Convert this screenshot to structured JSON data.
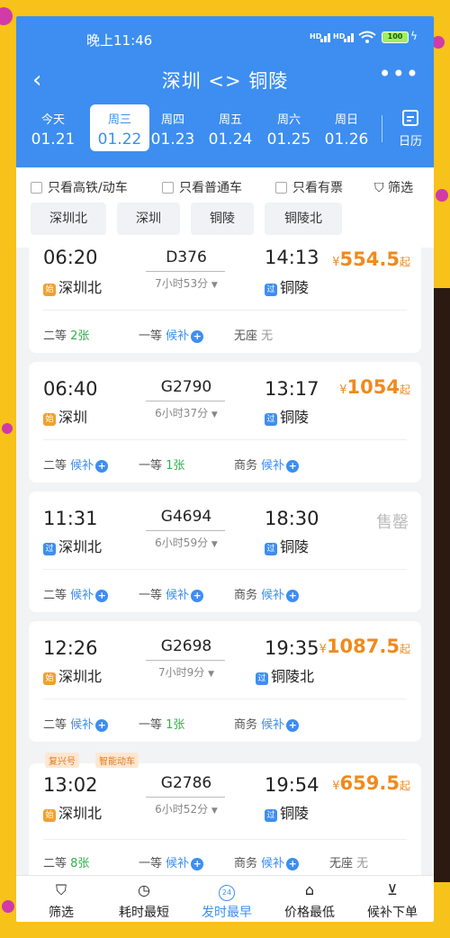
{
  "status": {
    "time": "晚上11:46",
    "battery": "100",
    "sig1": "HD",
    "sig2": "HD"
  },
  "nav": {
    "title": "深圳 <> 铜陵"
  },
  "dates": [
    {
      "weekday": "今天",
      "date": "01.21"
    },
    {
      "weekday": "周三",
      "date": "01.22",
      "selected": true
    },
    {
      "weekday": "周四",
      "date": "01.23"
    },
    {
      "weekday": "周五",
      "date": "01.24"
    },
    {
      "weekday": "周六",
      "date": "01.25"
    },
    {
      "weekday": "周日",
      "date": "01.26"
    }
  ],
  "calendar_label": "日历",
  "filters": {
    "highspeed": "只看高铁/动车",
    "normal": "只看普通车",
    "available": "只看有票",
    "filter": "筛选"
  },
  "stations": [
    "深圳北",
    "深圳",
    "铜陵",
    "铜陵北"
  ],
  "trains": [
    {
      "dep_time": "06:20",
      "train_no": "D376",
      "arr_time": "14:13",
      "duration": "7小时53分",
      "dep_station": "深圳北",
      "dep_badge": "始",
      "arr_station": "铜陵",
      "arr_badge": "过",
      "currency": "¥",
      "price": "554.5",
      "price_suffix": "起",
      "seats": [
        {
          "class": "二等",
          "status": "2张"
        },
        {
          "class": "一等",
          "status": "候补"
        },
        {
          "class": "无座",
          "status": "无"
        }
      ]
    },
    {
      "dep_time": "06:40",
      "train_no": "G2790",
      "arr_time": "13:17",
      "duration": "6小时37分",
      "dep_station": "深圳",
      "dep_badge": "始",
      "arr_station": "铜陵",
      "arr_badge": "过",
      "currency": "¥",
      "price": "1054",
      "price_suffix": "起",
      "seats": [
        {
          "class": "二等",
          "status": "候补"
        },
        {
          "class": "一等",
          "status": "1张"
        },
        {
          "class": "商务",
          "status": "候补"
        }
      ]
    },
    {
      "dep_time": "11:31",
      "train_no": "G4694",
      "arr_time": "18:30",
      "duration": "6小时59分",
      "dep_station": "深圳北",
      "dep_badge": "过",
      "arr_station": "铜陵",
      "arr_badge": "过",
      "soldout": "售罄",
      "seats": [
        {
          "class": "二等",
          "status": "候补"
        },
        {
          "class": "一等",
          "status": "候补"
        },
        {
          "class": "商务",
          "status": "候补"
        }
      ]
    },
    {
      "dep_time": "12:26",
      "train_no": "G2698",
      "arr_time": "19:35",
      "duration": "7小时9分",
      "dep_station": "深圳北",
      "dep_badge": "始",
      "arr_station": "铜陵北",
      "arr_badge": "过",
      "currency": "¥",
      "price": "1087.5",
      "price_suffix": "起",
      "seats": [
        {
          "class": "二等",
          "status": "候补"
        },
        {
          "class": "一等",
          "status": "1张"
        },
        {
          "class": "商务",
          "status": "候补"
        }
      ]
    },
    {
      "tags": [
        "复兴号",
        "智能动车"
      ],
      "dep_time": "13:02",
      "train_no": "G2786",
      "arr_time": "19:54",
      "duration": "6小时52分",
      "dep_station": "深圳北",
      "dep_badge": "始",
      "arr_station": "铜陵",
      "arr_badge": "过",
      "currency": "¥",
      "price": "659.5",
      "price_suffix": "起",
      "seats": [
        {
          "class": "二等",
          "status": "8张"
        },
        {
          "class": "一等",
          "status": "候补"
        },
        {
          "class": "商务",
          "status": "候补"
        },
        {
          "class": "无座",
          "status": "无"
        }
      ]
    }
  ],
  "tabbar": [
    {
      "label": "筛选",
      "icon": "funnel-icon"
    },
    {
      "label": "耗时最短",
      "icon": "timer-icon"
    },
    {
      "label": "发时最早",
      "icon": "clock-24-icon",
      "active": true,
      "icon_text": "24"
    },
    {
      "label": "价格最低",
      "icon": "price-tag-icon"
    },
    {
      "label": "候补下单",
      "icon": "cart-icon"
    }
  ],
  "colors": {
    "primary": "#3d8ef0",
    "price": "#f08a1c",
    "available": "#2fb34a"
  }
}
